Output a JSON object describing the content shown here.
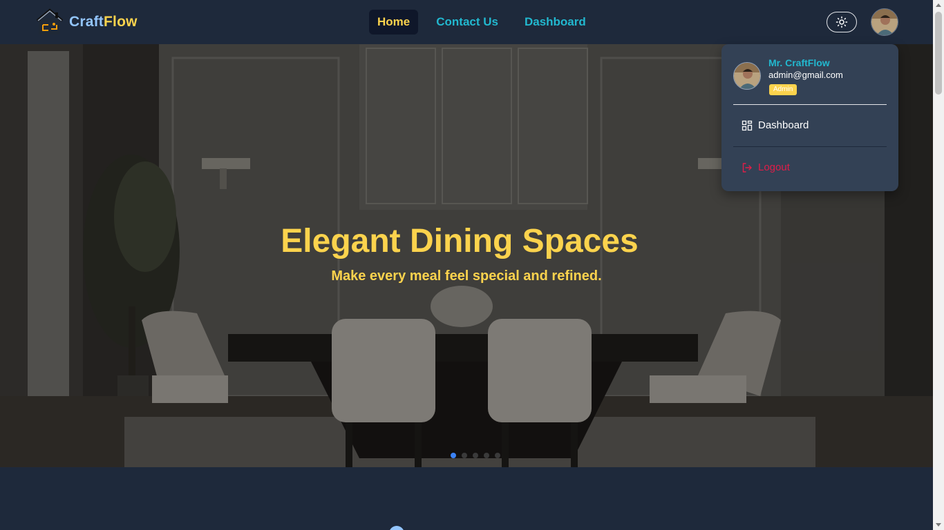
{
  "navbar": {
    "brand_part1": "Craft",
    "brand_part2": "Flow",
    "links": [
      {
        "label": "Home",
        "active": true
      },
      {
        "label": "Contact Us",
        "active": false
      },
      {
        "label": "Dashboard",
        "active": false
      }
    ],
    "theme_icon": "sun-icon",
    "avatar_icon": "user-avatar"
  },
  "hero": {
    "title": "Elegant Dining Spaces",
    "subtitle": "Make every meal feel special and refined.",
    "slides_count": 5,
    "active_slide": 1
  },
  "dropdown": {
    "name": "Mr. CraftFlow",
    "email": "admin@gmail.com",
    "role_badge": "Admin",
    "items": [
      {
        "label": "Dashboard",
        "icon": "dashboard-grid-icon"
      },
      {
        "label": "Logout",
        "icon": "logout-icon"
      }
    ]
  },
  "colors": {
    "accent_yellow": "#fcd34d",
    "accent_cyan": "#22b8cf",
    "background": "#1e293b",
    "dropdown_bg": "#334155",
    "logout_red": "#e11d48"
  }
}
